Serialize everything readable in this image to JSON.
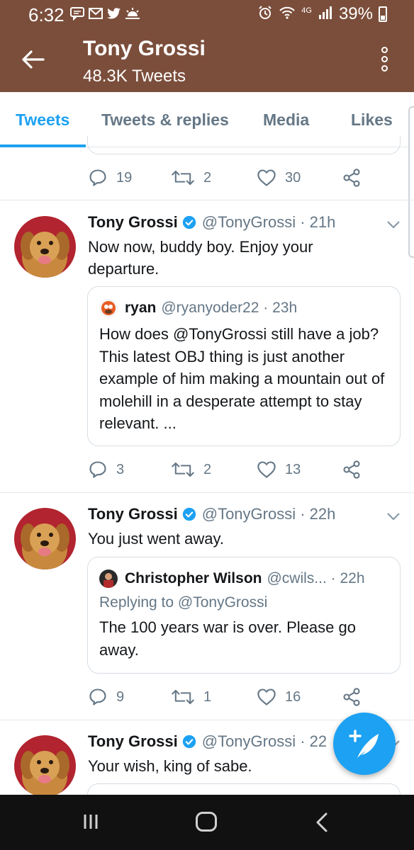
{
  "status_bar": {
    "time": "6:32",
    "network": "4G",
    "battery": "39%",
    "icons": [
      "messages-icon",
      "gmail-icon",
      "twitter-icon",
      "weather-icon",
      "alarm-icon",
      "wifi-icon",
      "signal-icon",
      "battery-icon"
    ]
  },
  "header": {
    "name": "Tony Grossi",
    "tweets_count": "48.3K Tweets"
  },
  "tabs": [
    {
      "label": "Tweets",
      "active": true
    },
    {
      "label": "Tweets & replies",
      "active": false
    },
    {
      "label": "Media",
      "active": false
    },
    {
      "label": "Likes",
      "active": false
    }
  ],
  "tweets": [
    {
      "partial": true,
      "replies": "19",
      "retweets": "2",
      "likes": "30"
    },
    {
      "name": "Tony Grossi",
      "handle": "@TonyGrossi · 21h",
      "text": "Now now, buddy boy. Enjoy your departure.",
      "quote": {
        "name": "ryan",
        "handle": "@ryanyoder22 · 23h",
        "text": "How does @TonyGrossi still have a job? This latest OBJ thing is just another example of him making a mountain out of molehill in a desperate attempt to stay relevant. ..."
      },
      "replies": "3",
      "retweets": "2",
      "likes": "13"
    },
    {
      "name": "Tony Grossi",
      "handle": "@TonyGrossi · 22h",
      "text": "You just went away.",
      "quote": {
        "name": "Christopher Wilson",
        "handle": "@cwils... · 22h",
        "reply_to": "Replying to @TonyGrossi",
        "text": "The 100 years war is over. Please go away."
      },
      "replies": "9",
      "retweets": "1",
      "likes": "16"
    },
    {
      "name": "Tony Grossi",
      "handle": "@TonyGrossi · 22",
      "text": "Your wish, king of sabe."
    }
  ],
  "colors": {
    "header_bg": "#7b4e3b",
    "accent": "#1da1f2",
    "secondary_text": "#657786"
  }
}
